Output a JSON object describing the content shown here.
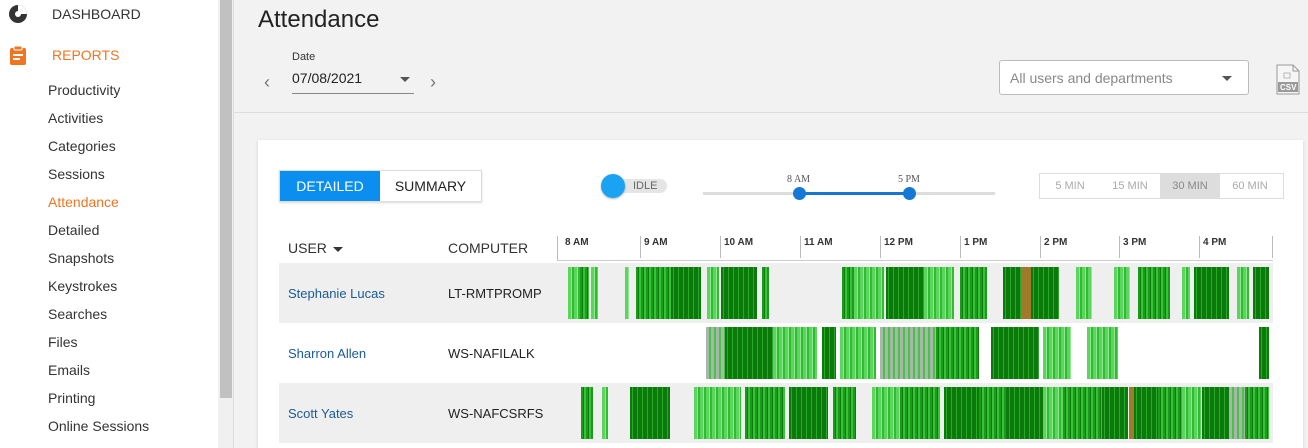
{
  "sidebar": {
    "dashboard_label": "DASHBOARD",
    "reports_label": "REPORTS",
    "items": [
      {
        "label": "Productivity"
      },
      {
        "label": "Activities"
      },
      {
        "label": "Categories"
      },
      {
        "label": "Sessions"
      },
      {
        "label": "Attendance",
        "active": true
      },
      {
        "label": "Detailed"
      },
      {
        "label": "Snapshots"
      },
      {
        "label": "Keystrokes"
      },
      {
        "label": "Searches"
      },
      {
        "label": "Files"
      },
      {
        "label": "Emails"
      },
      {
        "label": "Printing"
      },
      {
        "label": "Online Sessions"
      }
    ]
  },
  "header": {
    "title": "Attendance",
    "date_label": "Date",
    "date_value": "07/08/2021",
    "prev_icon": "chevron-left-icon",
    "next_icon": "chevron-right-icon",
    "user_filter_placeholder": "All users and departments",
    "csv_label": "CSV"
  },
  "controls": {
    "view_tabs": [
      "DETAILED",
      "SUMMARY"
    ],
    "active_view": "DETAILED",
    "idle_label": "IDLE",
    "range_start": "8 AM",
    "range_end": "5 PM",
    "granularity": [
      "5 MIN",
      "15 MIN",
      "30 MIN",
      "60 MIN"
    ],
    "selected_granularity": "30 MIN"
  },
  "table": {
    "col_user": "USER",
    "col_computer": "COMPUTER",
    "time_axis": {
      "start_hour": 7.93,
      "end_hour": 16.9,
      "labels": [
        "8 AM",
        "9 AM",
        "10 AM",
        "11 AM",
        "12 PM",
        "1 PM",
        "2 PM",
        "3 PM",
        "4 PM"
      ]
    },
    "rows": [
      {
        "user": "Stephanie Lucas",
        "computer": "LT-RMTPROMP",
        "segments": [
          {
            "start": 8.02,
            "end": 8.17,
            "status": "active-light"
          },
          {
            "start": 8.17,
            "end": 8.28,
            "status": "active"
          },
          {
            "start": 8.31,
            "end": 8.39,
            "status": "active-light"
          },
          {
            "start": 8.73,
            "end": 8.78,
            "status": "active-light"
          },
          {
            "start": 8.88,
            "end": 9.32,
            "status": "active"
          },
          {
            "start": 9.32,
            "end": 9.7,
            "status": "active-dense"
          },
          {
            "start": 9.77,
            "end": 9.92,
            "status": "active-light"
          },
          {
            "start": 9.95,
            "end": 10.4,
            "status": "active-dense"
          },
          {
            "start": 10.46,
            "end": 10.55,
            "status": "active"
          },
          {
            "start": 11.47,
            "end": 11.62,
            "status": "active"
          },
          {
            "start": 11.62,
            "end": 12.0,
            "status": "active-light"
          },
          {
            "start": 12.03,
            "end": 12.5,
            "status": "active-dense"
          },
          {
            "start": 12.5,
            "end": 12.88,
            "status": "active-light"
          },
          {
            "start": 12.95,
            "end": 13.3,
            "status": "active"
          },
          {
            "start": 13.5,
            "end": 13.72,
            "status": "active-dense"
          },
          {
            "start": 13.72,
            "end": 13.85,
            "status": "warn"
          },
          {
            "start": 13.85,
            "end": 14.2,
            "status": "active-dense"
          },
          {
            "start": 14.42,
            "end": 14.62,
            "status": "active-light"
          },
          {
            "start": 14.9,
            "end": 15.1,
            "status": "active-light"
          },
          {
            "start": 15.2,
            "end": 15.6,
            "status": "active"
          },
          {
            "start": 15.75,
            "end": 15.85,
            "status": "active-light"
          },
          {
            "start": 15.9,
            "end": 16.35,
            "status": "active-dense"
          },
          {
            "start": 16.45,
            "end": 16.6,
            "status": "active-light"
          },
          {
            "start": 16.65,
            "end": 16.85,
            "status": "active-dense"
          }
        ]
      },
      {
        "user": "Sharron Allen",
        "computer": "WS-NAFILALK",
        "segments": [
          {
            "start": 9.75,
            "end": 10.0,
            "status": "idle"
          },
          {
            "start": 10.0,
            "end": 10.6,
            "status": "active-dense"
          },
          {
            "start": 10.6,
            "end": 11.15,
            "status": "active-light"
          },
          {
            "start": 11.22,
            "end": 11.4,
            "status": "active-dense"
          },
          {
            "start": 11.45,
            "end": 11.9,
            "status": "active-light"
          },
          {
            "start": 11.95,
            "end": 12.65,
            "status": "idle"
          },
          {
            "start": 12.65,
            "end": 13.2,
            "status": "active"
          },
          {
            "start": 13.35,
            "end": 13.95,
            "status": "active-dense"
          },
          {
            "start": 14.0,
            "end": 14.35,
            "status": "active-light"
          },
          {
            "start": 14.55,
            "end": 14.95,
            "status": "active-light"
          },
          {
            "start": 16.72,
            "end": 16.85,
            "status": "active-dense"
          }
        ]
      },
      {
        "user": "Scott Yates",
        "computer": "WS-NAFCSRFS",
        "segments": [
          {
            "start": 8.18,
            "end": 8.33,
            "status": "active"
          },
          {
            "start": 8.45,
            "end": 8.52,
            "status": "active-light"
          },
          {
            "start": 8.8,
            "end": 9.3,
            "status": "active-dense"
          },
          {
            "start": 9.6,
            "end": 10.2,
            "status": "active-light"
          },
          {
            "start": 10.25,
            "end": 10.75,
            "status": "active"
          },
          {
            "start": 10.8,
            "end": 11.3,
            "status": "active-dense"
          },
          {
            "start": 11.35,
            "end": 11.65,
            "status": "active"
          },
          {
            "start": 11.85,
            "end": 12.2,
            "status": "active-light"
          },
          {
            "start": 12.2,
            "end": 12.7,
            "status": "active"
          },
          {
            "start": 12.75,
            "end": 13.2,
            "status": "active-dense"
          },
          {
            "start": 13.2,
            "end": 13.55,
            "status": "active"
          },
          {
            "start": 13.55,
            "end": 14.0,
            "status": "active-dense"
          },
          {
            "start": 14.0,
            "end": 14.25,
            "status": "active-light"
          },
          {
            "start": 14.25,
            "end": 14.75,
            "status": "active"
          },
          {
            "start": 14.75,
            "end": 15.08,
            "status": "active-dense"
          },
          {
            "start": 15.08,
            "end": 15.15,
            "status": "warn"
          },
          {
            "start": 15.15,
            "end": 15.45,
            "status": "active-dense"
          },
          {
            "start": 15.45,
            "end": 15.75,
            "status": "active"
          },
          {
            "start": 15.75,
            "end": 16.0,
            "status": "active-light"
          },
          {
            "start": 16.0,
            "end": 16.35,
            "status": "active-dense"
          },
          {
            "start": 16.35,
            "end": 16.55,
            "status": "idle"
          },
          {
            "start": 16.55,
            "end": 16.85,
            "status": "active"
          }
        ]
      }
    ]
  },
  "colors": {
    "accent": "#f07522",
    "primary": "#0a8ef0",
    "link": "#1a5a99",
    "active": "#1c9a1c",
    "active-dense": "#0a7a0a",
    "active-light": "#5fd35f",
    "idle": "#a8b8a8",
    "warn": "#a07a2a"
  }
}
